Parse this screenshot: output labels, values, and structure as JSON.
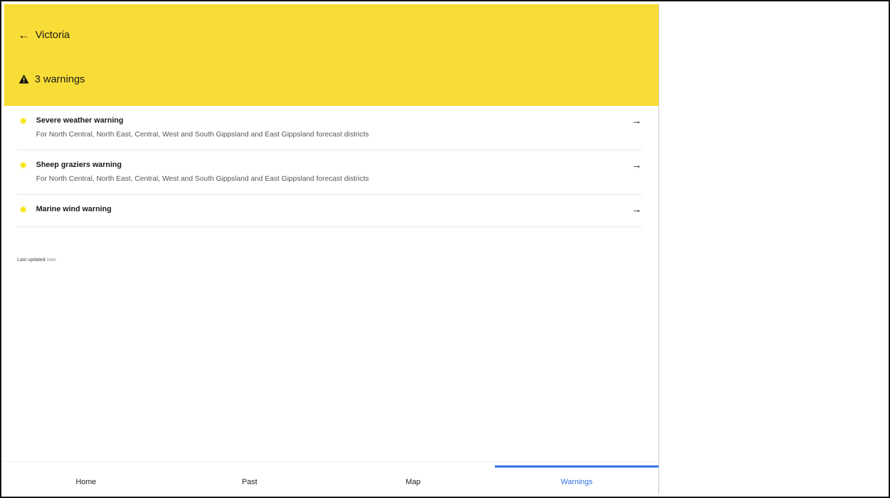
{
  "header": {
    "back_arrow": "←",
    "back_label": "Victoria",
    "warning_icon": "warning-triangle-icon",
    "warning_count": "3 warnings",
    "color": "#f9dd37"
  },
  "warnings": [
    {
      "title": "Severe weather warning",
      "subtitle": "For North Central, North East, Central, West and South Gippsland and East Gippsland forecast districts",
      "arrow": "→"
    },
    {
      "title": "Sheep graziers warning",
      "subtitle": "For North Central, North East, Central, West and South Gippsland and East Gippsland forecast districts",
      "arrow": "→"
    },
    {
      "title": "Marine wind warning",
      "arrow": "→"
    }
  ],
  "status": {
    "last_updated_label": "Last updated",
    "last_updated_value": "now"
  },
  "tabs": [
    {
      "label": "Home",
      "active": false
    },
    {
      "label": "Past",
      "active": false
    },
    {
      "label": "Map",
      "active": false
    },
    {
      "label": "Warnings",
      "active": true
    }
  ],
  "colors": {
    "accent": "#2f6fe0",
    "warning_dot": "#f5e50a"
  }
}
